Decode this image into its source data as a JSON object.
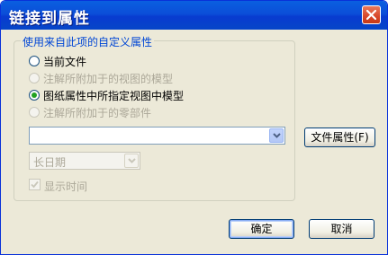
{
  "window": {
    "title": "链接到属性"
  },
  "group": {
    "legend": "使用来自此项的自定义属性",
    "options": [
      {
        "label": "当前文件",
        "selected": false,
        "enabled": true
      },
      {
        "label": "注解所附加于的视图的模型",
        "selected": false,
        "enabled": false
      },
      {
        "label": "图纸属性中所指定视图中模型",
        "selected": true,
        "enabled": true
      },
      {
        "label": "注解所附加于的零部件",
        "selected": false,
        "enabled": false
      }
    ],
    "property_combo": {
      "value": ""
    },
    "date_format": {
      "value": "长日期",
      "enabled": false
    },
    "show_time": {
      "label": "显示时间",
      "checked": true,
      "enabled": false
    }
  },
  "buttons": {
    "file_properties": "文件属性(F)",
    "ok": "确定",
    "cancel": "取消"
  },
  "colors": {
    "titlebar": "#0a5fe0",
    "legend": "#0046d5",
    "selected_dot": "#21a121"
  }
}
